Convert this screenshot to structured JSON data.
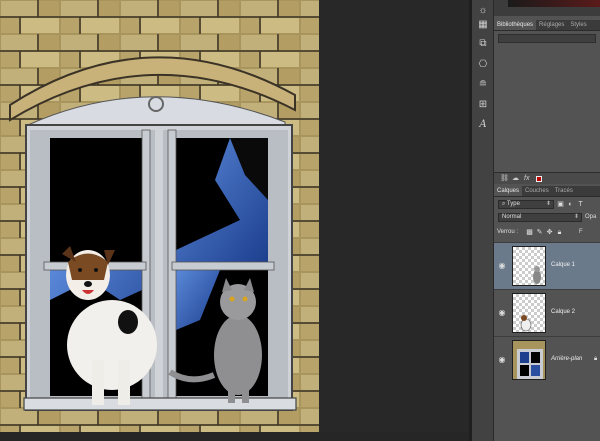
{
  "panels": {
    "top_tabs": [
      {
        "label": "Bibliothèques",
        "active": true
      },
      {
        "label": "Réglages",
        "active": false
      },
      {
        "label": "Styles",
        "active": false
      }
    ],
    "layer_tabs": [
      {
        "label": "Calques",
        "active": true
      },
      {
        "label": "Couches",
        "active": false
      },
      {
        "label": "Tracés",
        "active": false
      }
    ],
    "filter_label": "Type",
    "blend_mode": "Normal",
    "opacity_label": "Opa",
    "lock_label": "Verrou :",
    "fill_label": "F",
    "layers": [
      {
        "name": "Calque 1",
        "selected": true,
        "italic": false
      },
      {
        "name": "Calque 2",
        "selected": false,
        "italic": false
      },
      {
        "name": "Arrière-plan",
        "selected": false,
        "italic": true
      }
    ]
  },
  "tools": [
    "sun-icon",
    "calendar-icon",
    "layers-3d-icon",
    "paths-icon",
    "adjust-icon",
    "text-tool-icon"
  ],
  "colors": {
    "panel": "#535353",
    "selected_layer": "#6b7a8a",
    "workspace": "#282828",
    "accent_red": "#b00000"
  }
}
